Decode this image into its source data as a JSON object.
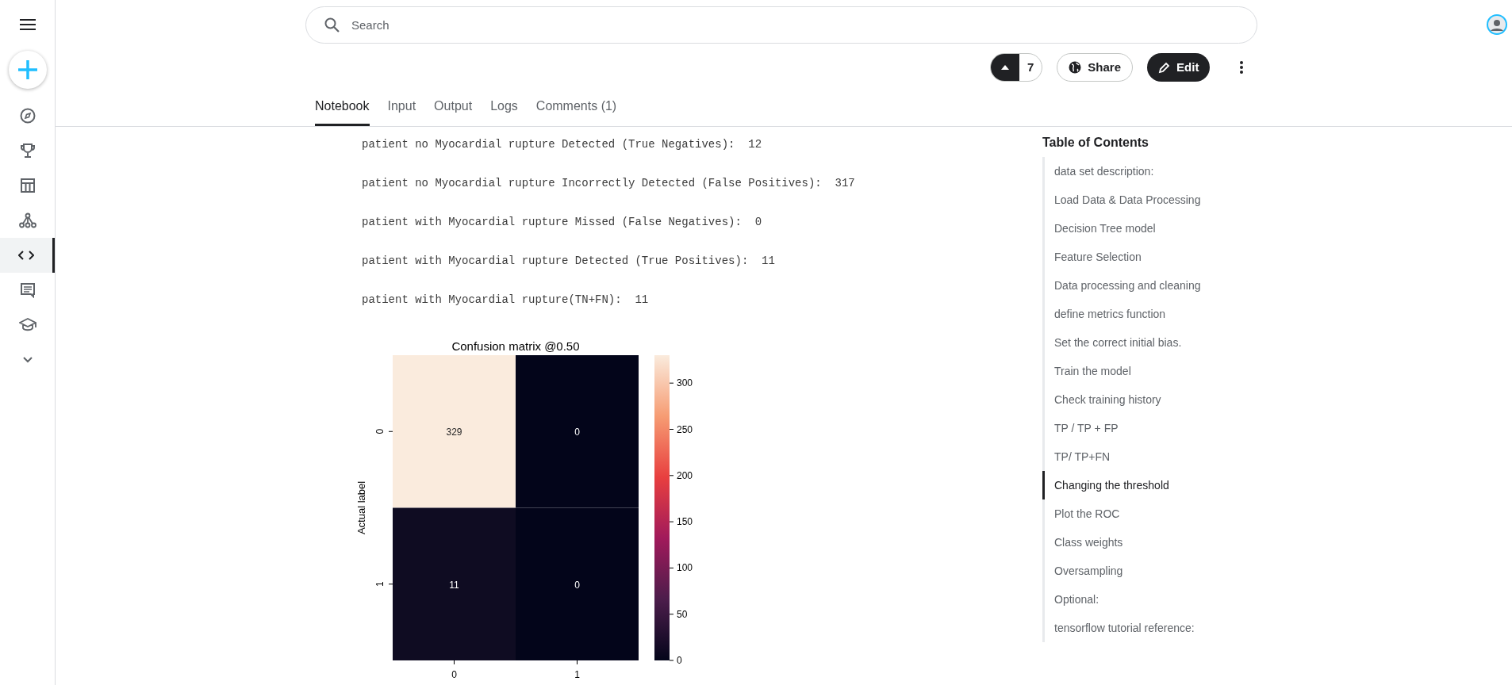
{
  "sidebar": {
    "items": [
      {
        "selected": false
      },
      {
        "selected": false
      },
      {
        "selected": false
      },
      {
        "selected": false
      },
      {
        "selected": true
      },
      {
        "selected": false
      },
      {
        "selected": false
      }
    ]
  },
  "search": {
    "placeholder": "Search"
  },
  "actions": {
    "vote_count": "7",
    "share": "Share",
    "edit": "Edit"
  },
  "tabs": [
    {
      "label": "Notebook",
      "selected": true
    },
    {
      "label": "Input",
      "selected": false
    },
    {
      "label": "Output",
      "selected": false
    },
    {
      "label": "Logs",
      "selected": false
    },
    {
      "label": "Comments (1)",
      "selected": false
    }
  ],
  "output_lines": [
    "patient no Myocardial rupture Detected (True Negatives):  12",
    "patient no Myocardial rupture Incorrectly Detected (False Positives):  317",
    "patient with Myocardial rupture Missed (False Negatives):  0",
    "patient with Myocardial rupture Detected (True Positives):  11",
    "patient with Myocardial rupture(TN+FN):  11"
  ],
  "heatmap": {
    "title": "Confusion matrix @0.50",
    "ylabel": "Actual label",
    "xticks": [
      "0",
      "1"
    ],
    "yticks": [
      "0",
      "1"
    ],
    "cells": [
      [
        {
          "value": "329",
          "color": "#faebdd"
        },
        {
          "value": "0",
          "color": "#03051a"
        }
      ],
      [
        {
          "value": "11",
          "color": "#0f0c22"
        },
        {
          "value": "0",
          "color": "#03051a"
        }
      ]
    ],
    "colorbar_ticks": [
      "300",
      "250",
      "200",
      "150",
      "100",
      "50",
      "0"
    ]
  },
  "toc": {
    "title": "Table of Contents",
    "items": [
      {
        "label": "data set description:",
        "selected": false
      },
      {
        "label": "Load Data & Data Processing",
        "selected": false
      },
      {
        "label": "Decision Tree model",
        "selected": false
      },
      {
        "label": "Feature Selection",
        "selected": false
      },
      {
        "label": "Data processing and cleaning",
        "selected": false
      },
      {
        "label": "define metrics function",
        "selected": false
      },
      {
        "label": "Set the correct initial bias.",
        "selected": false
      },
      {
        "label": "Train the model",
        "selected": false
      },
      {
        "label": "Check training history",
        "selected": false
      },
      {
        "label": "TP / TP + FP",
        "selected": false
      },
      {
        "label": "TP/ TP+FN",
        "selected": false
      },
      {
        "label": "Changing the threshold",
        "selected": true
      },
      {
        "label": "Plot the ROC",
        "selected": false
      },
      {
        "label": "Class weights",
        "selected": false
      },
      {
        "label": "Oversampling",
        "selected": false
      },
      {
        "label": "Optional:",
        "selected": false
      },
      {
        "label": "tensorflow tutorial reference:",
        "selected": false
      }
    ]
  }
}
